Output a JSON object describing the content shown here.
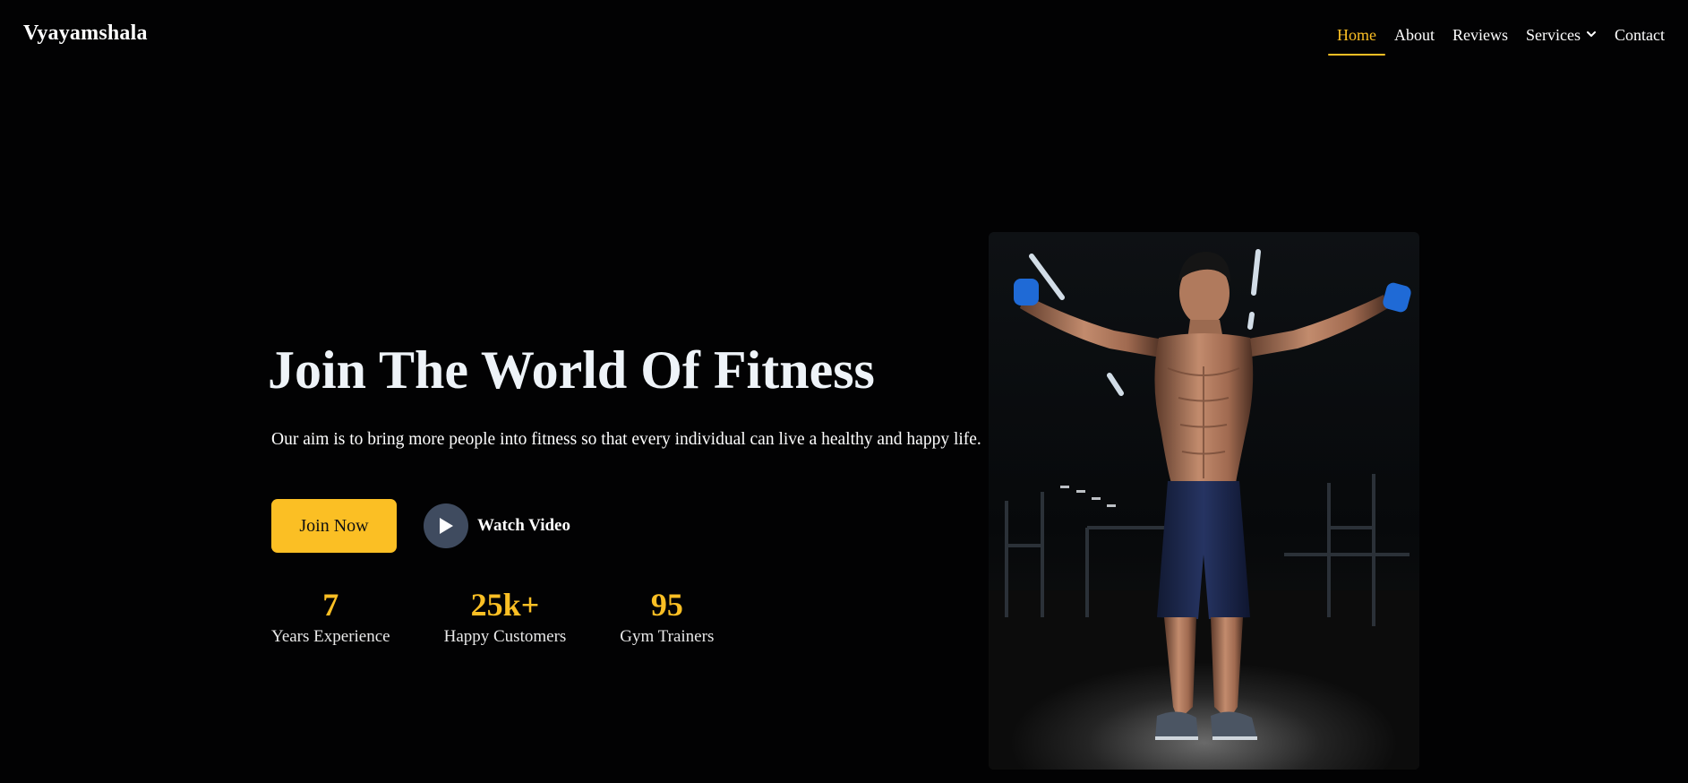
{
  "brand": {
    "name": "Vyayamshala"
  },
  "nav": {
    "items": [
      {
        "label": "Home",
        "active": true
      },
      {
        "label": "About"
      },
      {
        "label": "Reviews"
      },
      {
        "label": "Services",
        "icon": "chevron-down-icon"
      },
      {
        "label": "Contact"
      }
    ]
  },
  "hero": {
    "title": "Join The World Of Fitness",
    "subtitle": "Our aim is to bring more people into fitness so that every individual can live a healthy and happy life.",
    "primary_button": "Join Now",
    "video_button": {
      "label": "Watch Video",
      "icon": "play-icon"
    },
    "stats": [
      {
        "value": "7",
        "label": "Years Experience"
      },
      {
        "value": "25k+",
        "label": "Happy Customers"
      },
      {
        "value": "95",
        "label": "Gym Trainers"
      }
    ],
    "image": {
      "subject": "shirtless athlete holding blue dumbbells in a dark gym"
    }
  },
  "colors": {
    "background": "#020203",
    "accent": "#fbbf24",
    "play_circle": "#3f4b5f",
    "text": "#ffffff"
  }
}
